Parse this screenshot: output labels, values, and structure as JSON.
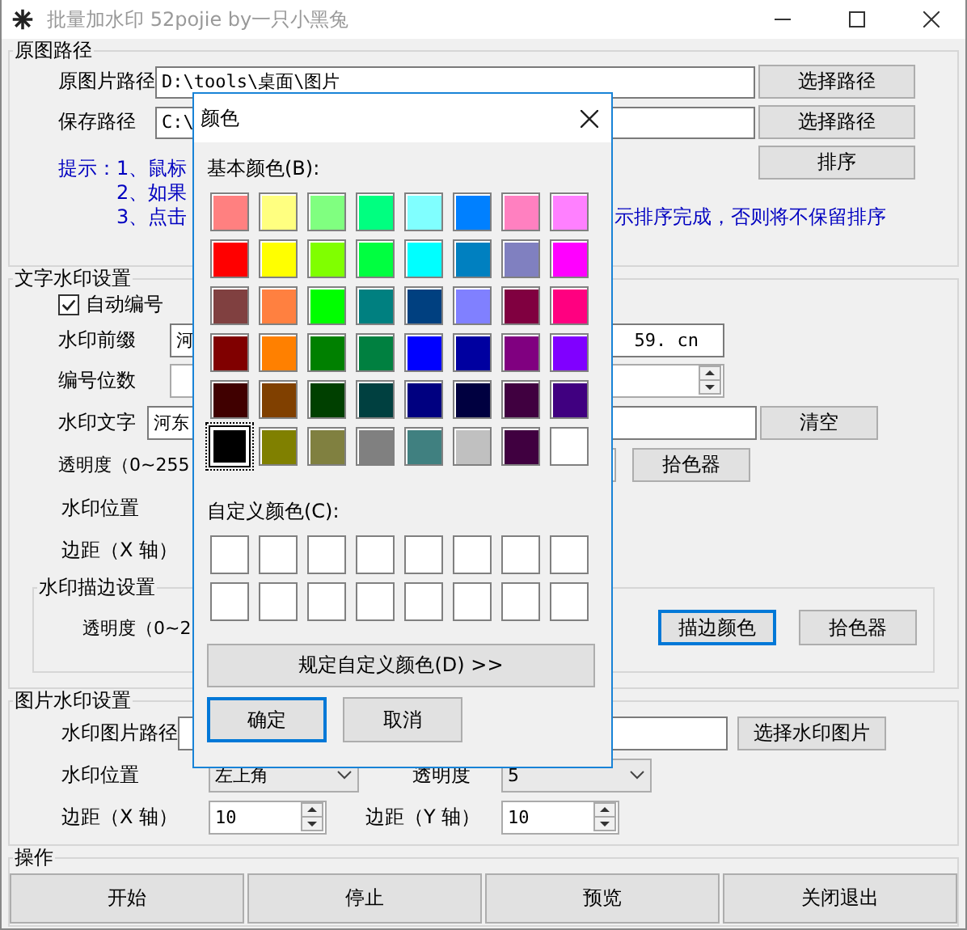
{
  "window": {
    "title": "批量加水印 52pojie by一只小黑兔"
  },
  "source_group": {
    "title": "原图路径",
    "rows": [
      {
        "label": "原图片路径",
        "value": "D:\\tools\\桌面\\图片",
        "button": "选择路径"
      },
      {
        "label": "保存路径",
        "value": "C:\\",
        "button": "选择路径"
      }
    ],
    "sort_button": "排序",
    "tips": {
      "heading": "提示：",
      "lines": [
        "1、鼠标",
        "2、如果",
        "3、点击"
      ],
      "tail": "示排序完成，否则将不保留排序"
    }
  },
  "text_group": {
    "title": "文字水印设置",
    "auto_number": {
      "label": "自动编号",
      "checked": true
    },
    "prefix": {
      "label": "水印前缀",
      "value_start": "河",
      "value_end": "59. cn"
    },
    "digits": {
      "label": "编号位数"
    },
    "text": {
      "label": "水印文字",
      "value": "河东",
      "button": "清空"
    },
    "opacity": {
      "label": "透明度（0~255",
      "button": "拾色器"
    },
    "position": {
      "label": "水印位置"
    },
    "margin_x": {
      "label": "边距（X 轴）"
    },
    "outline": {
      "title": "水印描边设置",
      "opacity_label": "透明度（0~2",
      "buttons": [
        {
          "label": "描边颜色",
          "focused": true
        },
        {
          "label": "拾色器",
          "focused": false
        }
      ]
    }
  },
  "image_group": {
    "title": "图片水印设置",
    "path": {
      "label": "水印图片路径",
      "button": "选择水印图片"
    },
    "position": {
      "label": "水印位置",
      "value": "左上角"
    },
    "opacity": {
      "label": "透明度",
      "value": "5"
    },
    "margin_x": {
      "label": "边距（X 轴）",
      "value": "10"
    },
    "margin_y": {
      "label": "边距（Y 轴）",
      "value": "10"
    }
  },
  "actions": {
    "title": "操作",
    "buttons": [
      "开始",
      "停止",
      "预览",
      "关闭退出"
    ]
  },
  "color_dialog": {
    "title": "颜色",
    "basic_label": "基本颜色(B):",
    "basic_colors": [
      {
        "color": "#ff8080",
        "selected": false
      },
      {
        "color": "#ffff80",
        "selected": false
      },
      {
        "color": "#80ff80",
        "selected": false
      },
      {
        "color": "#00ff80",
        "selected": false
      },
      {
        "color": "#80ffff",
        "selected": false
      },
      {
        "color": "#0080ff",
        "selected": false
      },
      {
        "color": "#ff80c0",
        "selected": false
      },
      {
        "color": "#ff80ff",
        "selected": false
      },
      {
        "color": "#ff0000",
        "selected": false
      },
      {
        "color": "#ffff00",
        "selected": false
      },
      {
        "color": "#80ff00",
        "selected": false
      },
      {
        "color": "#00ff40",
        "selected": false
      },
      {
        "color": "#00ffff",
        "selected": false
      },
      {
        "color": "#0080c0",
        "selected": false
      },
      {
        "color": "#8080c0",
        "selected": false
      },
      {
        "color": "#ff00ff",
        "selected": false
      },
      {
        "color": "#804040",
        "selected": false
      },
      {
        "color": "#ff8040",
        "selected": false
      },
      {
        "color": "#00ff00",
        "selected": false
      },
      {
        "color": "#008080",
        "selected": false
      },
      {
        "color": "#004080",
        "selected": false
      },
      {
        "color": "#8080ff",
        "selected": false
      },
      {
        "color": "#800040",
        "selected": false
      },
      {
        "color": "#ff0080",
        "selected": false
      },
      {
        "color": "#800000",
        "selected": false
      },
      {
        "color": "#ff8000",
        "selected": false
      },
      {
        "color": "#008000",
        "selected": false
      },
      {
        "color": "#008040",
        "selected": false
      },
      {
        "color": "#0000ff",
        "selected": false
      },
      {
        "color": "#0000a0",
        "selected": false
      },
      {
        "color": "#800080",
        "selected": false
      },
      {
        "color": "#8000ff",
        "selected": false
      },
      {
        "color": "#400000",
        "selected": false
      },
      {
        "color": "#804000",
        "selected": false
      },
      {
        "color": "#004000",
        "selected": false
      },
      {
        "color": "#004040",
        "selected": false
      },
      {
        "color": "#000080",
        "selected": false
      },
      {
        "color": "#000040",
        "selected": false
      },
      {
        "color": "#400040",
        "selected": false
      },
      {
        "color": "#400080",
        "selected": false
      },
      {
        "color": "#000000",
        "selected": true
      },
      {
        "color": "#808000",
        "selected": false
      },
      {
        "color": "#808040",
        "selected": false
      },
      {
        "color": "#808080",
        "selected": false
      },
      {
        "color": "#408080",
        "selected": false
      },
      {
        "color": "#c0c0c0",
        "selected": false
      },
      {
        "color": "#400040",
        "selected": false
      },
      {
        "color": "#ffffff",
        "selected": false
      }
    ],
    "custom_label": "自定义颜色(C):",
    "custom_colors": [
      {
        "color": "#ffffff"
      },
      {
        "color": "#ffffff"
      },
      {
        "color": "#ffffff"
      },
      {
        "color": "#ffffff"
      },
      {
        "color": "#ffffff"
      },
      {
        "color": "#ffffff"
      },
      {
        "color": "#ffffff"
      },
      {
        "color": "#ffffff"
      },
      {
        "color": "#ffffff"
      },
      {
        "color": "#ffffff"
      },
      {
        "color": "#ffffff"
      },
      {
        "color": "#ffffff"
      },
      {
        "color": "#ffffff"
      },
      {
        "color": "#ffffff"
      },
      {
        "color": "#ffffff"
      },
      {
        "color": "#ffffff"
      }
    ],
    "define_button": "规定自定义颜色(D) >>",
    "buttons": [
      {
        "label": "确定",
        "focused": true
      },
      {
        "label": "取消",
        "focused": false
      }
    ]
  }
}
